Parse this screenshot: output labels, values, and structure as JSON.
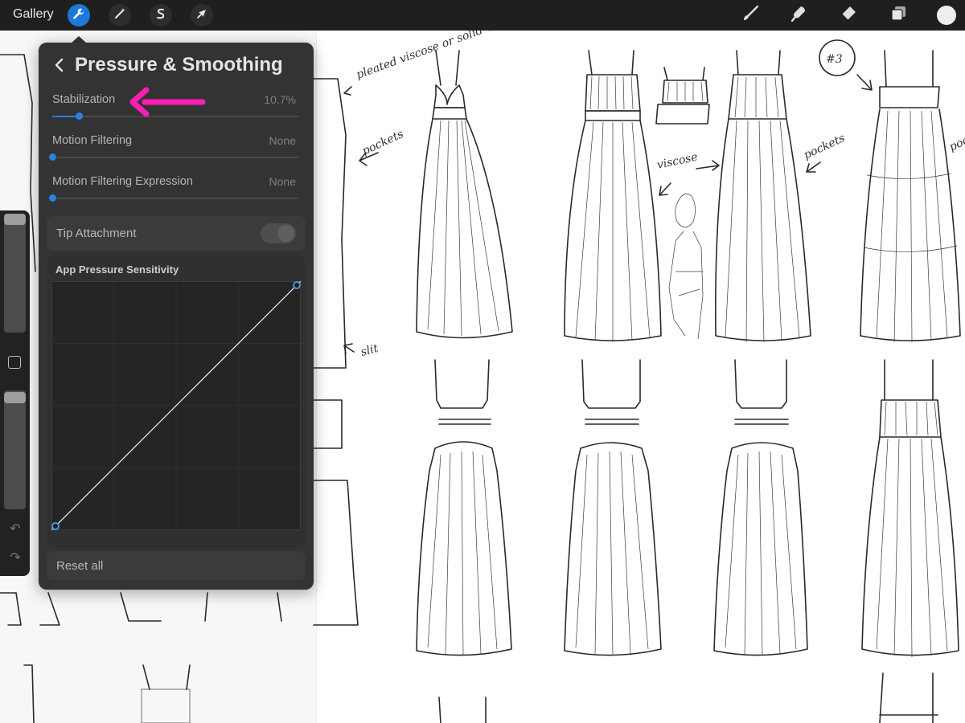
{
  "toolbar": {
    "gallery_label": "Gallery",
    "tools": [
      {
        "icon": "wrench-icon",
        "active": true
      },
      {
        "icon": "magic-wand-icon",
        "active": false
      },
      {
        "icon": "selection-icon",
        "active": false
      },
      {
        "icon": "transform-arrow-icon",
        "active": false
      }
    ],
    "right_tools": [
      "brush-icon",
      "smudge-icon",
      "eraser-icon",
      "layers-icon",
      "color-icon"
    ],
    "accent_color": "#1e78d9"
  },
  "popover": {
    "title": "Pressure & Smoothing",
    "settings": [
      {
        "label": "Stabilization",
        "value": "10.7%",
        "level": 0.107
      },
      {
        "label": "Motion Filtering",
        "value": "None",
        "level": 0
      },
      {
        "label": "Motion Filtering Expression",
        "value": "None",
        "level": 0
      }
    ],
    "tip_attachment": {
      "label": "Tip Attachment",
      "enabled": false
    },
    "curve": {
      "title": "App Pressure Sensitivity",
      "points": [
        [
          0,
          0
        ],
        [
          1,
          1
        ]
      ]
    },
    "reset_label": "Reset all"
  },
  "annotation": {
    "arrow_color": "#ff1fb4"
  },
  "canvas_notes": [
    "pleated viscose or solid viscose",
    "pockets",
    "slit",
    "viscose",
    "pockets",
    "#3",
    "pockets"
  ]
}
